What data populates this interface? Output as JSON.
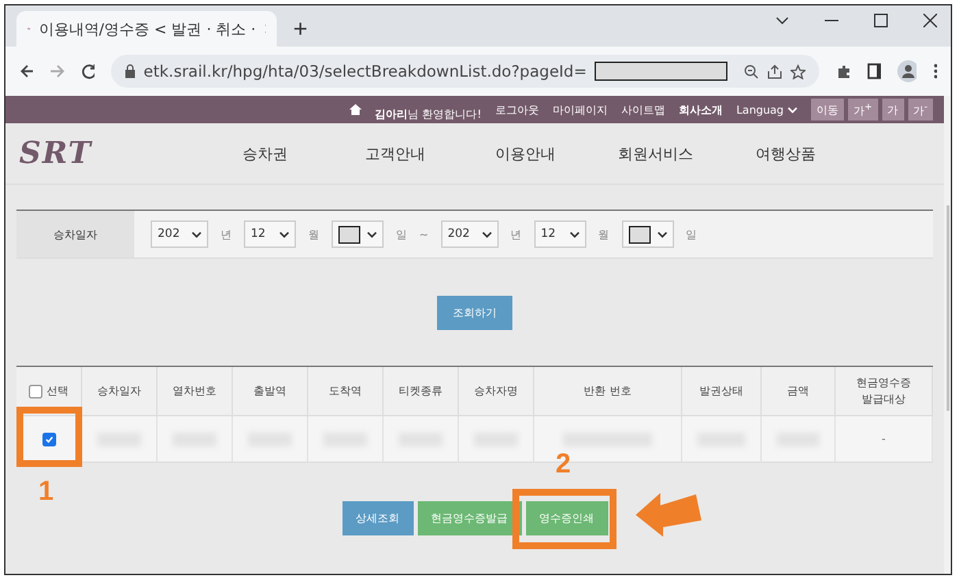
{
  "browser": {
    "tab_title": "이용내역/영수증 < 발권 · 취소 ·",
    "new_tab": "+",
    "url": "etk.srail.kr/hpg/hta/03/selectBreakdownList.do?pageId="
  },
  "top_bar": {
    "user_name": "김아리",
    "welcome": "님 환영합니다!",
    "links": [
      "로그아웃",
      "마이페이지",
      "사이트맵",
      "회사소개"
    ],
    "language": "Languag",
    "go": "이동",
    "font_sizes": [
      "가$^{+}$",
      "가",
      "가$^{-}$"
    ]
  },
  "logo": "SRT",
  "nav": [
    "승차권",
    "고객안내",
    "이용안내",
    "회원서비스",
    "여행상품"
  ],
  "filter": {
    "label": "승차일자",
    "separator": "~",
    "dates": [
      {
        "year": "202",
        "year_unit": "년",
        "month": "12",
        "month_unit": "월",
        "day_unit": "일"
      },
      {
        "year": "202",
        "year_unit": "년",
        "month": "12",
        "month_unit": "월",
        "day_unit": "일"
      }
    ]
  },
  "search_button": "조회하기",
  "table": {
    "select_all": {
      "label": "선택",
      "checked": false
    },
    "columns": [
      "승차일자",
      "열차번호",
      "출발역",
      "도착역",
      "티켓종류",
      "승차자명",
      "반환 번호",
      "발권상태",
      "금액",
      "현금영수증 발급대상"
    ],
    "rows": [
      {
        "selected": true,
        "cells": [
          {
            "kind": "blurred"
          },
          {
            "kind": "blurred"
          },
          {
            "kind": "blurred"
          },
          {
            "kind": "blurred"
          },
          {
            "kind": "blurred"
          },
          {
            "kind": "blurred"
          },
          {
            "kind": "blurred"
          },
          {
            "kind": "blurred"
          },
          {
            "kind": "blurred"
          },
          {
            "kind": "text",
            "text": "-"
          }
        ]
      }
    ]
  },
  "buttons": [
    {
      "label": "상세조회",
      "kind": "info"
    },
    {
      "label": "현금영수증발급",
      "kind": "success"
    },
    {
      "label": "영수증인쇄",
      "kind": "success"
    }
  ],
  "annotations": [
    {
      "label": "1"
    },
    {
      "label": "2"
    }
  ]
}
